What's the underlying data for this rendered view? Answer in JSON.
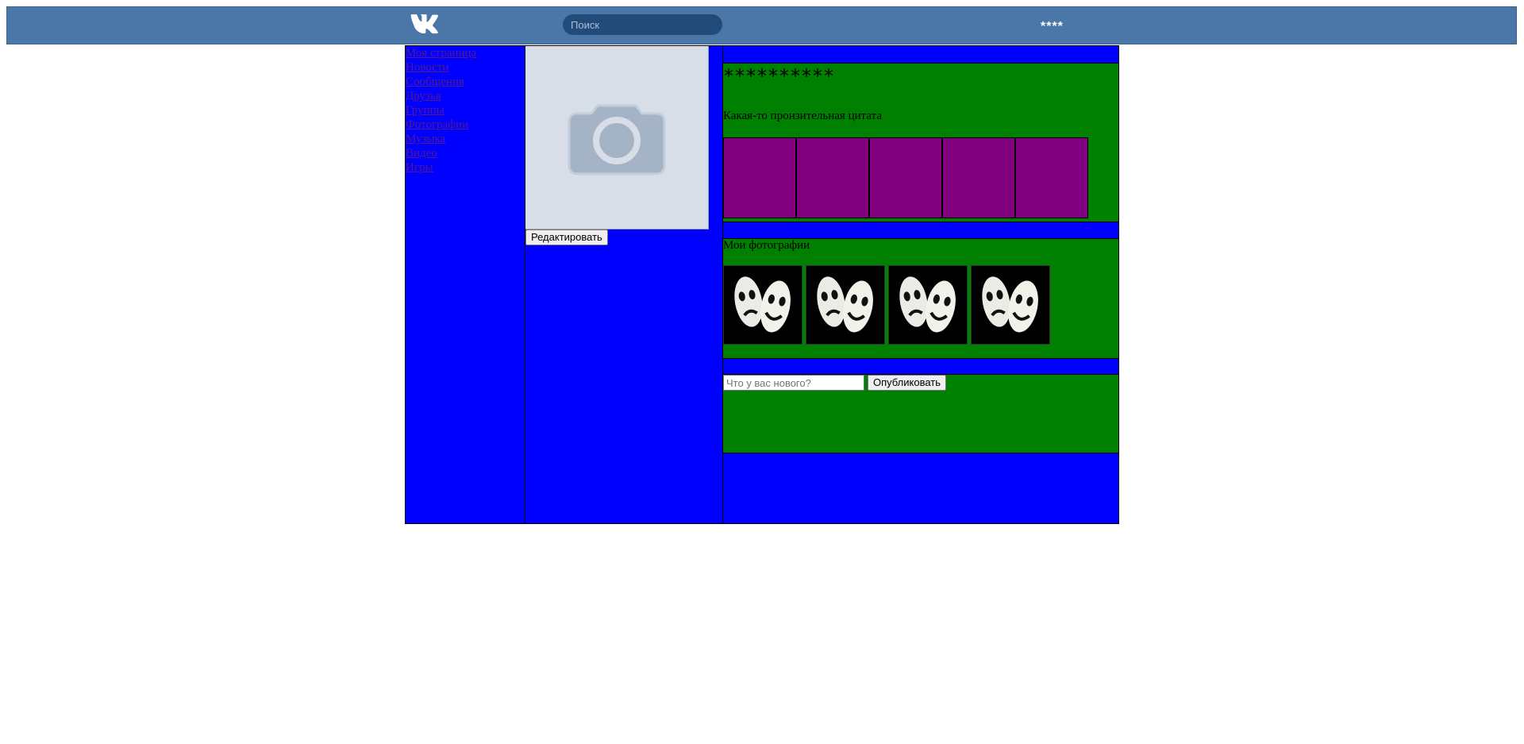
{
  "header": {
    "logo": "vk-logo-icon",
    "search_placeholder": "Поиск",
    "user_name": "****"
  },
  "nav": {
    "items": [
      {
        "label": "Моя страница"
      },
      {
        "label": "Новости"
      },
      {
        "label": "Сообщения"
      },
      {
        "label": "Друзья"
      },
      {
        "label": "Группы"
      },
      {
        "label": "Фотографии"
      },
      {
        "label": "Музыка"
      },
      {
        "label": "Видео"
      },
      {
        "label": "Игры"
      }
    ]
  },
  "profile": {
    "avatar_icon": "camera-icon",
    "edit_button": "Редактировать",
    "name": "**********",
    "quote": "Какая-то пронзительная цитата"
  },
  "photos": {
    "title": "Мои фотографии",
    "count": 4
  },
  "post": {
    "input_placeholder": "Что у вас нового?",
    "publish_button": "Опубликовать"
  },
  "colors": {
    "header": "#4a76a8",
    "search_bg": "#224b7a",
    "column_bg": "#0000ff",
    "panel_bg": "#008000",
    "box_bg": "#800080",
    "link": "#551a8b"
  }
}
